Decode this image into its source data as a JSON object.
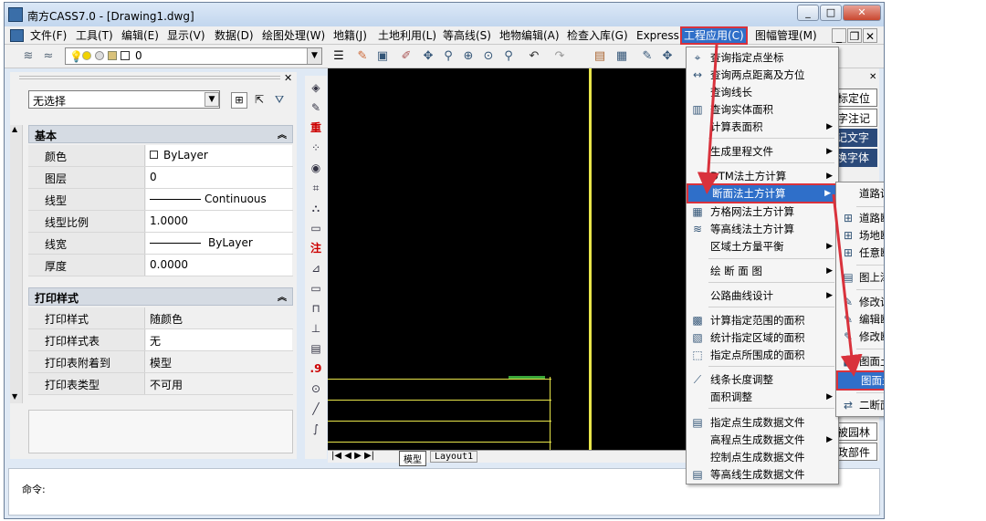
{
  "window": {
    "title": "南方CASS7.0 - [Drawing1.dwg]",
    "min": "_",
    "max": "□",
    "close": "✕"
  },
  "menu": {
    "items": [
      "文件(F)",
      "工具(T)",
      "编辑(E)",
      "显示(V)",
      "数据(D)",
      "绘图处理(W)",
      "地籍(J)",
      "土地利用(L)",
      "等高线(S)",
      "地物编辑(A)",
      "检查入库(G)",
      "Express",
      "工程应用(C)",
      "图幅管理(M)"
    ],
    "doc_min": "_",
    "doc_restore": "❐",
    "doc_close": "✕"
  },
  "toolbar": {
    "layer_value": "0"
  },
  "properties": {
    "selection": "无选择",
    "close": "✕",
    "basic_header": "基本",
    "basic_rows": [
      {
        "k": "颜色",
        "v": "ByLayer"
      },
      {
        "k": "图层",
        "v": "0"
      },
      {
        "k": "线型",
        "v": "Continuous"
      },
      {
        "k": "线型比例",
        "v": "1.0000"
      },
      {
        "k": "线宽",
        "v": "ByLayer"
      },
      {
        "k": "厚度",
        "v": "0.0000"
      }
    ],
    "print_header": "打印样式",
    "print_rows": [
      {
        "k": "打印样式",
        "v": "随颜色"
      },
      {
        "k": "打印样式表",
        "v": "无"
      },
      {
        "k": "打印表附着到",
        "v": "模型"
      },
      {
        "k": "打印表类型",
        "v": "不可用"
      }
    ]
  },
  "tabs": {
    "model": "模型",
    "layout": "Layout1"
  },
  "command": {
    "prompt": "命令:"
  },
  "dropdown": {
    "items": [
      {
        "label": "查询指定点坐标",
        "icon": "coord-icon"
      },
      {
        "label": "查询两点距离及方位",
        "icon": "distance-icon"
      },
      {
        "label": "查询线长",
        "icon": ""
      },
      {
        "label": "查询实体面积",
        "icon": "area-icon"
      },
      {
        "label": "计算表面积",
        "icon": "",
        "arrow": true
      },
      {
        "label": "生成里程文件",
        "icon": "",
        "arrow": true
      },
      {
        "label": "DTM法土方计算",
        "icon": "",
        "arrow": true
      },
      {
        "label": "断面法土方计算",
        "icon": "",
        "arrow": true
      },
      {
        "label": "方格网法土方计算",
        "icon": "grid-icon"
      },
      {
        "label": "等高线法土方计算",
        "icon": "contour-icon"
      },
      {
        "label": "区域土方量平衡",
        "icon": "",
        "arrow": true
      },
      {
        "label": "绘 断 面 图",
        "icon": "",
        "arrow": true
      },
      {
        "label": "公路曲线设计",
        "icon": "",
        "arrow": true
      },
      {
        "label": "计算指定范围的面积",
        "icon": "range-area-icon"
      },
      {
        "label": "统计指定区域的面积",
        "icon": "stat-area-icon"
      },
      {
        "label": "指定点所围成的面积",
        "icon": "point-area-icon"
      },
      {
        "label": "线条长度调整",
        "icon": "line-length-icon"
      },
      {
        "label": "面积调整",
        "icon": "",
        "arrow": true
      },
      {
        "label": "指定点生成数据文件",
        "icon": "point-data-icon"
      },
      {
        "label": "高程点生成数据文件",
        "icon": "",
        "arrow": true
      },
      {
        "label": "控制点生成数据文件",
        "icon": ""
      },
      {
        "label": "等高线生成数据文件",
        "icon": "contour-data-icon"
      }
    ]
  },
  "submenu": {
    "items": [
      {
        "label": "道路设计参数文件",
        "icon": ""
      },
      {
        "label": "道路断面",
        "icon": "road-section-icon"
      },
      {
        "label": "场地断面",
        "icon": "site-section-icon"
      },
      {
        "label": "任意断面",
        "icon": "any-section-icon"
      },
      {
        "label": "图上添加断面线",
        "icon": "add-section-icon"
      },
      {
        "label": "修改设计参数",
        "icon": "edit-param-icon"
      },
      {
        "label": "编辑断面线",
        "icon": "edit-line-icon"
      },
      {
        "label": "修改断面里程",
        "icon": "edit-mileage-icon"
      },
      {
        "label": "图面土方计算",
        "icon": "earthwork-icon"
      },
      {
        "label": "图面土方计算(excel)",
        "icon": ""
      },
      {
        "label": "二断面线间土方计算",
        "icon": "two-section-icon"
      }
    ]
  },
  "right_palette": [
    "标定位",
    "字注记",
    "记文字",
    "换字体",
    "被园林",
    "政部件"
  ],
  "colors": {
    "accent": "#2f6fc9",
    "highlight_box": "#d9323c",
    "canvas": "#000000"
  }
}
